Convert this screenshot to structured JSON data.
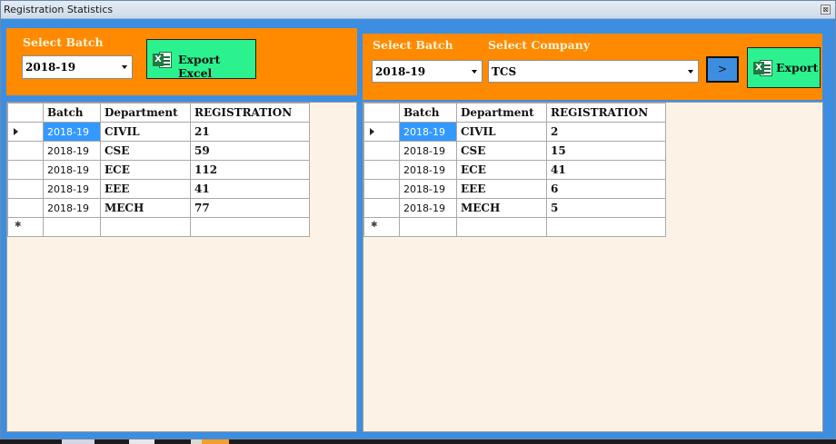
{
  "window": {
    "title": "Registration Statistics",
    "close_glyph": "⊠"
  },
  "left_panel": {
    "batch_label": "Select Batch",
    "batch_value": "2018-19",
    "export_label": "Export Excel",
    "columns": [
      "Batch",
      "Department",
      "REGISTRATION"
    ],
    "rows": [
      [
        "2018-19",
        "CIVIL",
        "21"
      ],
      [
        "2018-19",
        "CSE",
        "59"
      ],
      [
        "2018-19",
        "ECE",
        "112"
      ],
      [
        "2018-19",
        "EEE",
        "41"
      ],
      [
        "2018-19",
        "MECH",
        "77"
      ]
    ]
  },
  "right_panel": {
    "batch_label": "Select Batch",
    "batch_value": "2018-19",
    "company_label": "Select Company",
    "company_value": "TCS",
    "go_label": ">",
    "export_label": "Export",
    "columns": [
      "Batch",
      "Department",
      "REGISTRATION"
    ],
    "rows": [
      [
        "2018-19",
        "CIVIL",
        "2"
      ],
      [
        "2018-19",
        "CSE",
        "15"
      ],
      [
        "2018-19",
        "ECE",
        "41"
      ],
      [
        "2018-19",
        "EEE",
        "6"
      ],
      [
        "2018-19",
        "MECH",
        "5"
      ]
    ]
  },
  "icons": {
    "excel": "excel-icon",
    "current_row": "row-pointer-icon",
    "new_row": "new-row-icon",
    "dropdown": "chevron-down-icon"
  },
  "colors": {
    "window_bg": "#3d8ee0",
    "panel_orange": "#ff8a00",
    "export_green": "#2bf28f",
    "grid_bg": "#fcf3e6",
    "selection": "#3399ff"
  }
}
